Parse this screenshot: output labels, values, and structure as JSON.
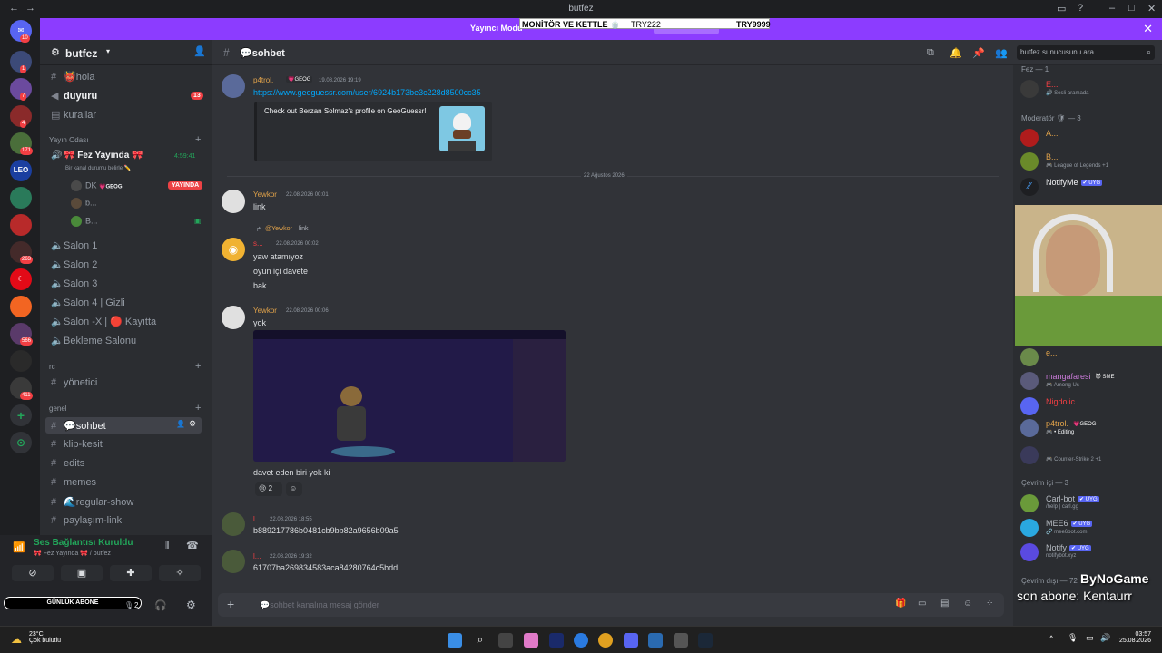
{
  "window": {
    "title": "butfez"
  },
  "banner": {
    "text": "Yayıncı Modu",
    "overlay_monitor": "MONİTÖR VE KETTLE 🍵",
    "overlay_try1": "TRY222",
    "overlay_try2": "TRY9999"
  },
  "servers": {
    "badges": [
      "10",
      "1",
      "7",
      "4",
      "171",
      "263",
      "566",
      "411"
    ]
  },
  "sidebar": {
    "guild_name": "butfez",
    "channels_top": [
      {
        "icon": "#",
        "label": "👹hola"
      },
      {
        "icon": "📢",
        "label": "duyuru",
        "badge": "13"
      },
      {
        "icon": "▤",
        "label": "kurallar"
      }
    ],
    "cat_yayin": "Yayın Odası",
    "voice_fez": "🎀 Fez Yayında 🎀",
    "voice_fez_time": "4:59:41",
    "voice_fez_status": "Bir kanal durumu belirle ✏️",
    "voice_users": [
      {
        "name": "DK",
        "tag": "💗GEOG",
        "live": "YAYINDA"
      },
      {
        "name": "b..."
      },
      {
        "name": "B..."
      }
    ],
    "salons": [
      "Salon 1",
      "Salon 2",
      "Salon 3",
      "Salon 4 | Gizli",
      "Salon -X | 🔴 Kayıtta",
      "Bekleme Salonu"
    ],
    "cat_rc": "rc",
    "yonetici": "yönetici",
    "cat_genel": "genel",
    "genel_channels": [
      "💬sohbet",
      "klip-kesit",
      "edits",
      "memes",
      "🌊regular-show",
      "paylaşım-link"
    ]
  },
  "voice_panel": {
    "status": "Ses Bağlantısı Kuruldu",
    "sub": "🎀 Fez Yayında 🎀 / butfez",
    "overlay": "GÜNLÜK ABONE",
    "overlay_num": "2"
  },
  "chat": {
    "channel_name": "💬sohbet",
    "messages": [
      {
        "user": "p4trol.",
        "tag": "💗GEOG",
        "time": "19.08.2026 19:19",
        "text": "https://www.geoguessr.com/user/6924b173be3c228d8500cc35"
      },
      {
        "user": "Yewkor",
        "time": "22.08.2026 00:01",
        "text": "link"
      },
      {
        "user": "s...",
        "time": "22.08.2026 00:02",
        "reply_user": "@Yewkor",
        "reply_text": "link",
        "lines": [
          "yaw atamıyoz",
          "oyun içi davete",
          "bak"
        ]
      },
      {
        "user": "Yewkor",
        "time": "22.08.2026 00:06",
        "text": "yok",
        "caption": "davet eden biri yok ki",
        "reaction_count": "2"
      },
      {
        "user": "l...",
        "time": "22.08.2026 18:55",
        "text": "b889217786b0481cb9bb82a9656b09a5"
      },
      {
        "user": "l...",
        "time": "22.08.2026 19:32",
        "text": "61707ba269834583aca84280764c5bdd"
      }
    ],
    "embed_text": "Check out Berzan Solmaz's profile on GeoGuessr!",
    "date_divider": "22 Ağustos 2026",
    "input_placeholder": "💬sohbet kanalına mesaj gönder"
  },
  "members": {
    "search_placeholder": "butfez sunucusunu ara",
    "sections": {
      "fez": "Fez — 1",
      "moderator": "Moderatör 🛡 — 3",
      "online": "Çevrim içi — 3",
      "offline": "Çevrim dışı — 72"
    },
    "fez_members": [
      {
        "name": "E...",
        "activity": "🔊 Sesli aramada"
      }
    ],
    "mod_members": [
      {
        "name": "A...",
        "activity": ""
      },
      {
        "name": "B...",
        "activity": "🎮 League of Legends +1"
      },
      {
        "name": "NotifyMe",
        "tag": "✔ UYG",
        "activity": ""
      }
    ],
    "other_members": [
      {
        "name": "e...",
        "activity": ""
      },
      {
        "name": "mangafaresi",
        "tag": "😈 SME",
        "activity": "🎮 Among Us"
      },
      {
        "name": "Nigdolic",
        "activity": ""
      },
      {
        "name": "p4trol.",
        "tag": "💗GEOG",
        "activity": "🎮 • Editing"
      },
      {
        "name": "...",
        "activity": "🎮 Counter-Strike 2 +1"
      }
    ],
    "online_members": [
      {
        "name": "Carl-bot",
        "tag": "✔ UYG",
        "activity": "/help | carl.gg"
      },
      {
        "name": "MEE6",
        "tag": "✔ UYG",
        "activity": "🔗 mee6bot.com"
      },
      {
        "name": "Notify",
        "tag": "✔ UYG",
        "activity": "notifybot.xyz"
      }
    ],
    "overlay_top": "ByNoGame",
    "overlay_bottom": "son abone: Kentaurr"
  },
  "taskbar": {
    "temp": "23°C",
    "weather": "Çok bulutlu",
    "time": "03:57",
    "date": "25.08.2026"
  }
}
